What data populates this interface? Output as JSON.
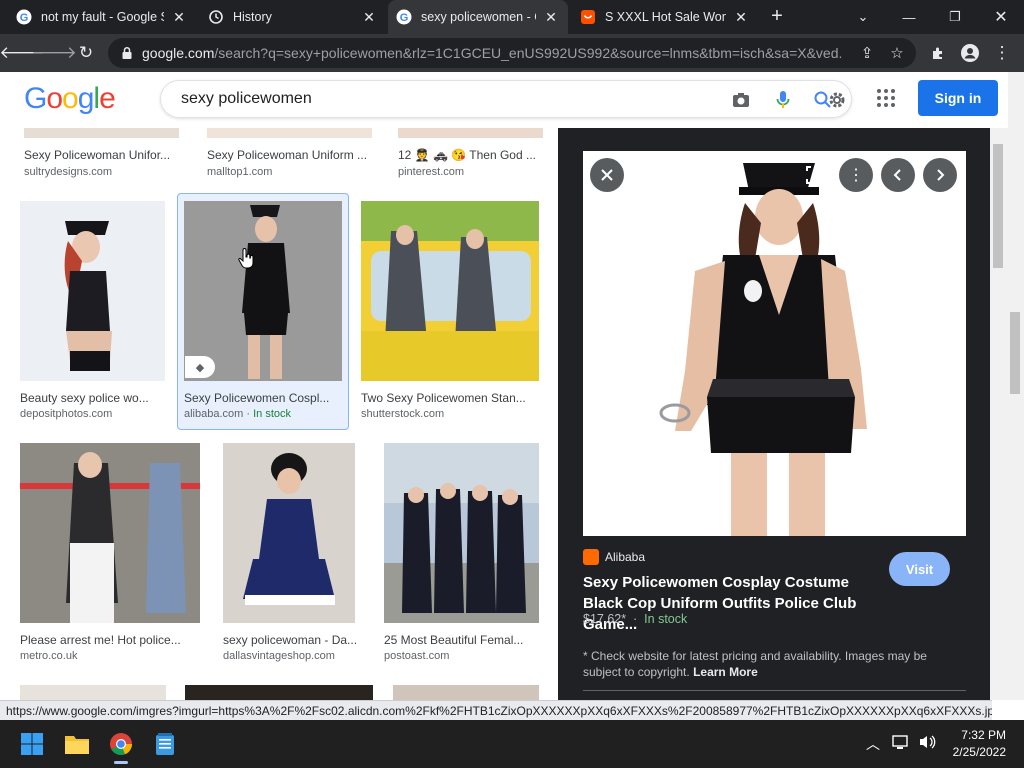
{
  "browser": {
    "tabs": [
      {
        "title": "not my fault - Google S",
        "favicon": "google-icon"
      },
      {
        "title": "History",
        "favicon": "history-icon"
      },
      {
        "title": "sexy policewomen - Go",
        "favicon": "google-icon",
        "active": true
      },
      {
        "title": "S XXXL Hot Sale Woma",
        "favicon": "alibaba-icon"
      }
    ],
    "address": {
      "host": "google.com",
      "path": "/search?q=sexy+policewomen&rlz=1C1GCEU_enUS992US992&source=lnms&tbm=isch&sa=X&ved..."
    }
  },
  "google": {
    "logo": "Google",
    "query": "sexy policewomen",
    "signin_label": "Sign in"
  },
  "results": [
    {
      "caption": "Sexy Policewoman Unifor...",
      "source": "sultrydesigns.com"
    },
    {
      "caption": "Sexy Policewoman Uniform ...",
      "source": "malltop1.com"
    },
    {
      "caption": "12 🧑‍✈️ 🚓 😘 Then God ...",
      "source": "pinterest.com"
    },
    {
      "caption": "Beauty sexy police wo...",
      "source": "depositphotos.com"
    },
    {
      "caption": "Sexy Policewomen Cospl...",
      "source": "alibaba.com",
      "stock": "In stock"
    },
    {
      "caption": "Two Sexy Policewomen Stan...",
      "source": "shutterstock.com"
    },
    {
      "caption": "Please arrest me! Hot police...",
      "source": "metro.co.uk"
    },
    {
      "caption": "sexy policewoman - Da...",
      "source": "dallasvintageshop.com"
    },
    {
      "caption": "25 Most Beautiful Femal...",
      "source": "postoast.com"
    }
  ],
  "preview": {
    "site": "Alibaba",
    "title": "Sexy Policewomen Cosplay Costume Black Cop Uniform Outfits Police Club Game...",
    "price": "$17.62*",
    "stock": "In stock",
    "visit_label": "Visit",
    "disclaimer": "* Check website for latest pricing and availability. Images may be subject to copyright.",
    "learn_more": "Learn More"
  },
  "status_url": "https://www.google.com/imgres?imgurl=https%3A%2F%2Fsc02.alicdn.com%2Fkf%2FHTB1cZixOpXXXXXXpXXq6xXFXXXs%2F200858977%2FHTB1cZixOpXXXXXXpXXq6xXFXXXs.jpg_...",
  "taskbar": {
    "time": "7:32 PM",
    "date": "2/25/2022"
  },
  "colors": {
    "google_blue": "#1a73e8",
    "stock_green": "#188038",
    "pane_bg": "#202124"
  }
}
